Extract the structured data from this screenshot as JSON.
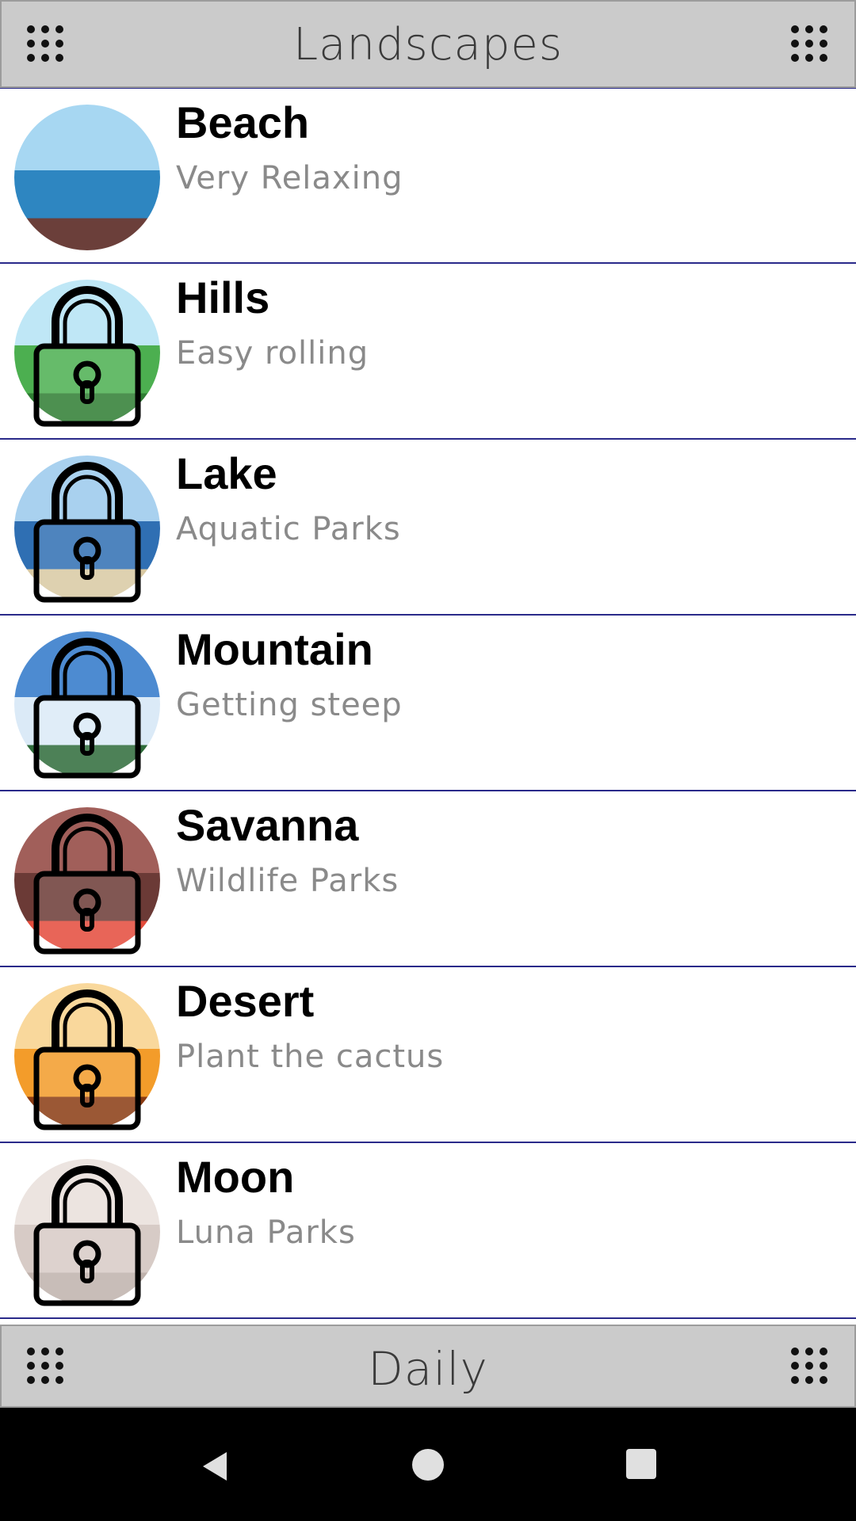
{
  "header": {
    "title": "Landscapes"
  },
  "footer": {
    "title": "Daily"
  },
  "items": [
    {
      "title": "Beach",
      "subtitle": "Very Relaxing",
      "locked": false,
      "colors": [
        "#a7d7f2",
        "#2e86c1",
        "#6b3f3a"
      ]
    },
    {
      "title": "Hills",
      "subtitle": "Easy rolling",
      "locked": true,
      "colors": [
        "#bfe7f6",
        "#4caf50",
        "#2e7d32"
      ]
    },
    {
      "title": "Lake",
      "subtitle": "Aquatic Parks",
      "locked": true,
      "colors": [
        "#a9d1ef",
        "#2f6fb3",
        "#d9c9a3"
      ]
    },
    {
      "title": "Mountain",
      "subtitle": "Getting steep",
      "locked": true,
      "colors": [
        "#4d8bd1",
        "#dbeaf7",
        "#2e6b3a"
      ]
    },
    {
      "title": "Savanna",
      "subtitle": "Wildlife Parks",
      "locked": true,
      "colors": [
        "#a15f5a",
        "#6b3a36",
        "#e44b3b"
      ]
    },
    {
      "title": "Desert",
      "subtitle": "Plant the cactus",
      "locked": true,
      "colors": [
        "#f9d89c",
        "#f39c2a",
        "#8a3b12"
      ]
    },
    {
      "title": "Moon",
      "subtitle": "Luna Parks",
      "locked": true,
      "colors": [
        "#ece4e0",
        "#d7cbc6",
        "#bfb2ac"
      ]
    }
  ]
}
